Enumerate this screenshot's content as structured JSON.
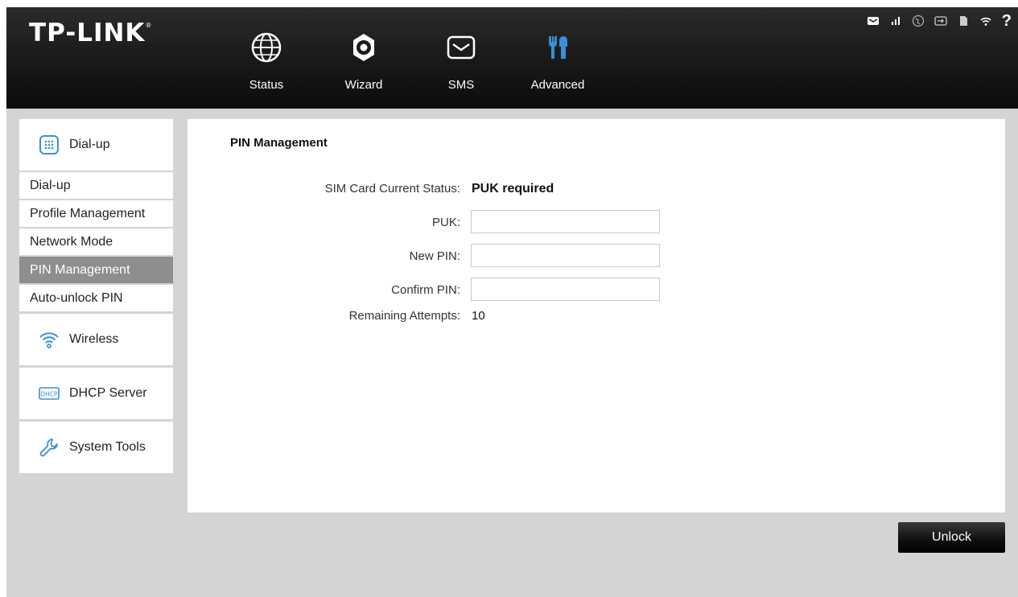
{
  "brand": {
    "logo_text": "TP-LINK",
    "logo_mark": "®"
  },
  "nav": [
    {
      "label": "Status",
      "icon": "globe-icon"
    },
    {
      "label": "Wizard",
      "icon": "gear-icon"
    },
    {
      "label": "SMS",
      "icon": "envelope-icon"
    },
    {
      "label": "Advanced",
      "icon": "tools-icon",
      "active": true
    }
  ],
  "status_bar": {
    "icons": [
      "message-icon",
      "signal-icon",
      "internet-icon",
      "battery-icon",
      "sd-card-icon",
      "wifi-icon"
    ],
    "help": "?"
  },
  "sidebar": {
    "groups": [
      {
        "label": "Dial-up",
        "icon": "dialpad-icon",
        "items": [
          "Dial-up",
          "Profile Management",
          "Network Mode",
          "PIN Management",
          "Auto-unlock PIN"
        ],
        "active_item": "PIN Management"
      },
      {
        "label": "Wireless",
        "icon": "wifi-icon"
      },
      {
        "label": "DHCP Server",
        "icon": "dhcp-icon",
        "icon_text": "DHCP"
      },
      {
        "label": "System Tools",
        "icon": "wrench-icon"
      }
    ]
  },
  "main": {
    "title": "PIN Management",
    "fields": {
      "sim_status": {
        "label": "SIM Card Current Status:",
        "value": "PUK required"
      },
      "puk": {
        "label": "PUK:",
        "value": ""
      },
      "new_pin": {
        "label": "New PIN:",
        "value": ""
      },
      "confirm_pin": {
        "label": "Confirm PIN:",
        "value": ""
      },
      "remaining": {
        "label": "Remaining Attempts:",
        "value": "10"
      }
    },
    "unlock_label": "Unlock"
  },
  "colors": {
    "accent_blue": "#3a8fd6",
    "header_dark": "#1a1a1a",
    "active_item_bg": "#8e8e8e",
    "frame_gray": "#d4d4d4"
  }
}
